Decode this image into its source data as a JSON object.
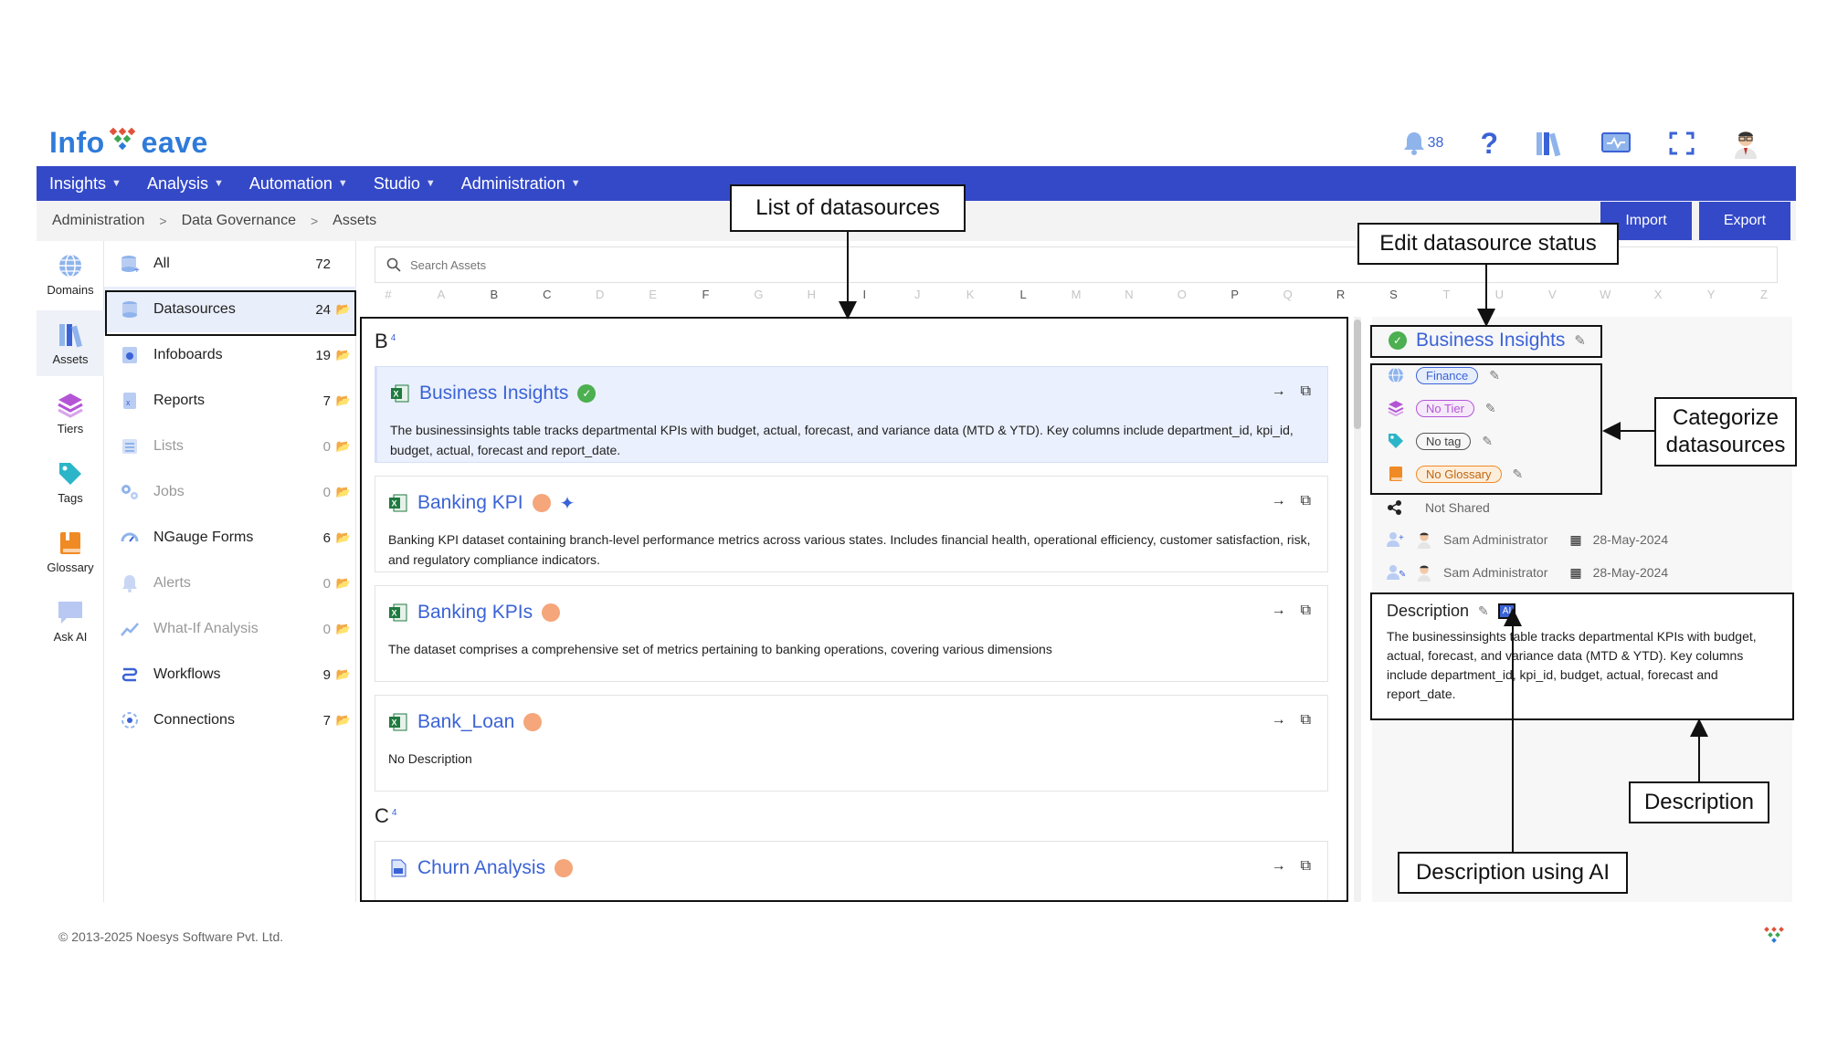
{
  "logo": {
    "text_left": "Info",
    "text_w": "W",
    "text_right": "eave"
  },
  "header": {
    "notification_count": "38"
  },
  "nav": {
    "items": [
      {
        "label": "Insights"
      },
      {
        "label": "Analysis"
      },
      {
        "label": "Automation"
      },
      {
        "label": "Studio"
      },
      {
        "label": "Administration"
      }
    ]
  },
  "breadcrumb": {
    "items": [
      "Administration",
      "Data Governance",
      "Assets"
    ]
  },
  "toolbar": {
    "import_label": "Import",
    "export_label": "Export"
  },
  "rail": {
    "items": [
      {
        "label": "Domains",
        "icon": "globe-icon"
      },
      {
        "label": "Assets",
        "icon": "assets-icon"
      },
      {
        "label": "Tiers",
        "icon": "layers-icon"
      },
      {
        "label": "Tags",
        "icon": "tag-icon"
      },
      {
        "label": "Glossary",
        "icon": "book-icon"
      },
      {
        "label": "Ask AI",
        "icon": "chat-icon"
      }
    ]
  },
  "categories": [
    {
      "label": "All",
      "count": "72"
    },
    {
      "label": "Datasources",
      "count": "24"
    },
    {
      "label": "Infoboards",
      "count": "19"
    },
    {
      "label": "Reports",
      "count": "7"
    },
    {
      "label": "Lists",
      "count": "0"
    },
    {
      "label": "Jobs",
      "count": "0"
    },
    {
      "label": "NGauge Forms",
      "count": "6"
    },
    {
      "label": "Alerts",
      "count": "0"
    },
    {
      "label": "What-If Analysis",
      "count": "0"
    },
    {
      "label": "Workflows",
      "count": "9"
    },
    {
      "label": "Connections",
      "count": "7"
    }
  ],
  "search": {
    "placeholder": "Search Assets"
  },
  "alphabet": [
    "#",
    "A",
    "B",
    "C",
    "D",
    "E",
    "F",
    "G",
    "H",
    "I",
    "J",
    "K",
    "L",
    "M",
    "N",
    "O",
    "P",
    "Q",
    "R",
    "S",
    "T",
    "U",
    "V",
    "W",
    "X",
    "Y",
    "Z"
  ],
  "groups": [
    {
      "letter": "B",
      "count": "4"
    },
    {
      "letter": "C",
      "count": "4"
    }
  ],
  "assets": [
    {
      "title": "Business Insights",
      "description": "The businessinsights table tracks departmental KPIs with budget, actual, forecast, and variance data (MTD & YTD). Key columns include department_id, kpi_id, budget, actual, forecast and report_date."
    },
    {
      "title": "Banking KPI",
      "description": "Banking KPI dataset containing branch-level performance metrics across various states. Includes financial health, operational efficiency, customer satisfaction, risk, and regulatory compliance indicators."
    },
    {
      "title": "Banking KPIs",
      "description": "The dataset comprises a comprehensive set of metrics pertaining to banking operations, covering various dimensions"
    },
    {
      "title": "Bank_Loan",
      "description": "No Description"
    },
    {
      "title": "Churn Analysis",
      "description": ""
    }
  ],
  "detail": {
    "title": "Business Insights",
    "domain": "Finance",
    "tier": "No Tier",
    "tag": "No tag",
    "glossary": "No Glossary",
    "shared": "Not Shared",
    "created_by": "Sam Administrator",
    "created_on": "28-May-2024",
    "modified_by": "Sam Administrator",
    "modified_on": "28-May-2024",
    "description_heading": "Description",
    "ai_badge": "AI",
    "description": "The businessinsights table tracks departmental KPIs with budget, actual, forecast, and variance data (MTD & YTD). Key columns include department_id, kpi_id, budget, actual, forecast and report_date."
  },
  "footer": {
    "copyright": "© 2013-2025 Noesys Software Pvt. Ltd."
  },
  "annotations": {
    "list": "List of datasources",
    "status": "Edit datasource status",
    "categorize": "Categorize datasources",
    "description": "Description",
    "ai": "Description using AI"
  },
  "colors": {
    "brand": "#3449c8",
    "link": "#3b63d6",
    "status_green": "#4caf50",
    "status_orange": "#f5a67a",
    "tier_purple": "#b455d6",
    "glossary_orange": "#f08a24"
  }
}
